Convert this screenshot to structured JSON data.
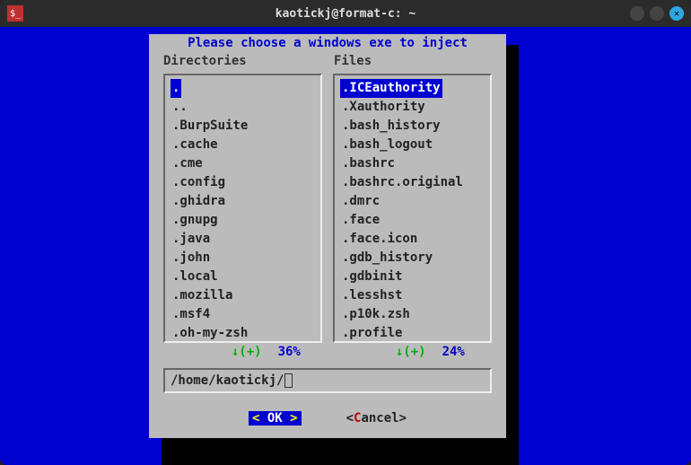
{
  "window": {
    "title": "kaotickj@format-c: ~"
  },
  "dialog": {
    "title": "Please choose a windows exe to inject",
    "directories_label": "Directories",
    "files_label": "Files",
    "directories": [
      ".",
      "..",
      ".BurpSuite",
      ".cache",
      ".cme",
      ".config",
      ".ghidra",
      ".gnupg",
      ".java",
      ".john",
      ".local",
      ".mozilla",
      ".msf4",
      ".oh-my-zsh"
    ],
    "dir_selected_index": 0,
    "files": [
      ".ICEauthority",
      ".Xauthority",
      ".bash_history",
      ".bash_logout",
      ".bashrc",
      ".bashrc.original",
      ".dmrc",
      ".face",
      ".face.icon",
      ".gdb_history",
      ".gdbinit",
      ".lesshst",
      ".p10k.zsh",
      ".profile"
    ],
    "file_selected_index": 0,
    "dir_scroll_indicator": "↓(+)",
    "dir_scroll_pct": "36%",
    "file_scroll_indicator": "↓(+)",
    "file_scroll_pct": "24%",
    "path": "/home/kaotickj/",
    "ok_arrow_left": "<",
    "ok_label": " OK ",
    "ok_arrow_right": ">",
    "cancel_open": "<",
    "cancel_first": "C",
    "cancel_rest": "ancel>",
    "cancel_label": "Cancel"
  }
}
